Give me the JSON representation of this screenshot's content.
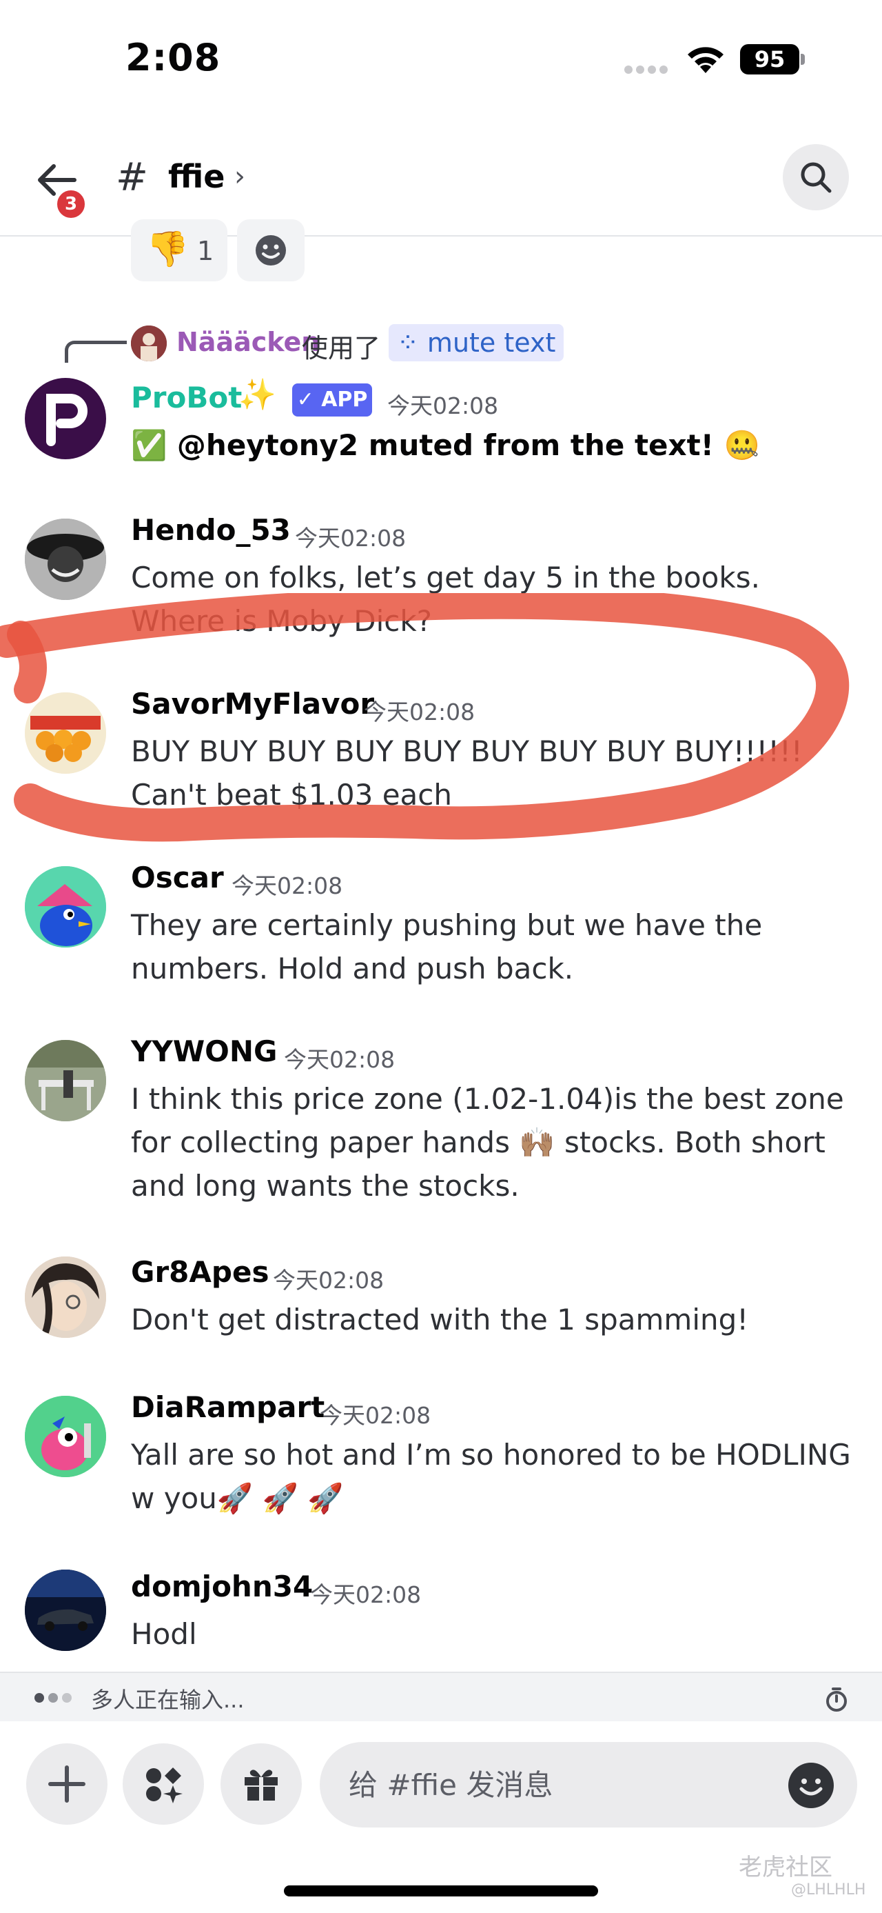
{
  "status": {
    "time": "2:08",
    "battery": "95"
  },
  "header": {
    "back_badge": "3",
    "hash": "#",
    "channel": "ffie",
    "chevron": "›"
  },
  "reactions": {
    "thumbs_down_emoji": "👎",
    "thumbs_down_count": "1"
  },
  "interaction": {
    "user": "Näääcken",
    "used": "使用了",
    "command": "mute text"
  },
  "messages": [
    {
      "author": "ProBot",
      "sparkle": "✨",
      "badge": "✓ APP",
      "time": "今天02:08",
      "text": "✅ @heytony2 muted from the text! 🤐"
    },
    {
      "author": "Hendo_53",
      "time": "今天02:08",
      "text": "Come on folks, let’s get day 5 in the books. Where is Moby Dick?"
    },
    {
      "author": "SavorMyFlavor",
      "time": "今天02:08",
      "text_line1": "BUY BUY BUY BUY BUY BUY BUY BUY BUY!!!!!!",
      "text_line2": "Can't beat $1.03 each"
    },
    {
      "author": "Oscar",
      "time": "今天02:08",
      "text": "They are certainly pushing but we have the numbers. Hold and push back."
    },
    {
      "author": "YYWONG",
      "time": "今天02:08",
      "text": "I think this price zone (1.02-1.04)is the best zone for collecting paper hands 🙌🏽 stocks.  Both short and long wants the stocks."
    },
    {
      "author": "Gr8Apes",
      "time": "今天02:08",
      "text": "Don't get distracted with the 1 spamming!"
    },
    {
      "author": "DiaRampart",
      "time": "今天02:08",
      "text": "Yall are so hot and I’m so honored to be HODLING w you🚀 🚀 🚀"
    },
    {
      "author": "domjohn34",
      "time": "今天02:08",
      "text": "Hodl"
    }
  ],
  "typing": {
    "text": "多人正在输入..."
  },
  "composer": {
    "placeholder": "给 #ffie 发消息"
  },
  "watermark": {
    "brand": "老虎社区",
    "handle": "@LHLHLH"
  },
  "colors": {
    "accent": "#5865f2",
    "probot": "#1abc9c",
    "marker": "#e8553f",
    "badge": "#da373c"
  }
}
